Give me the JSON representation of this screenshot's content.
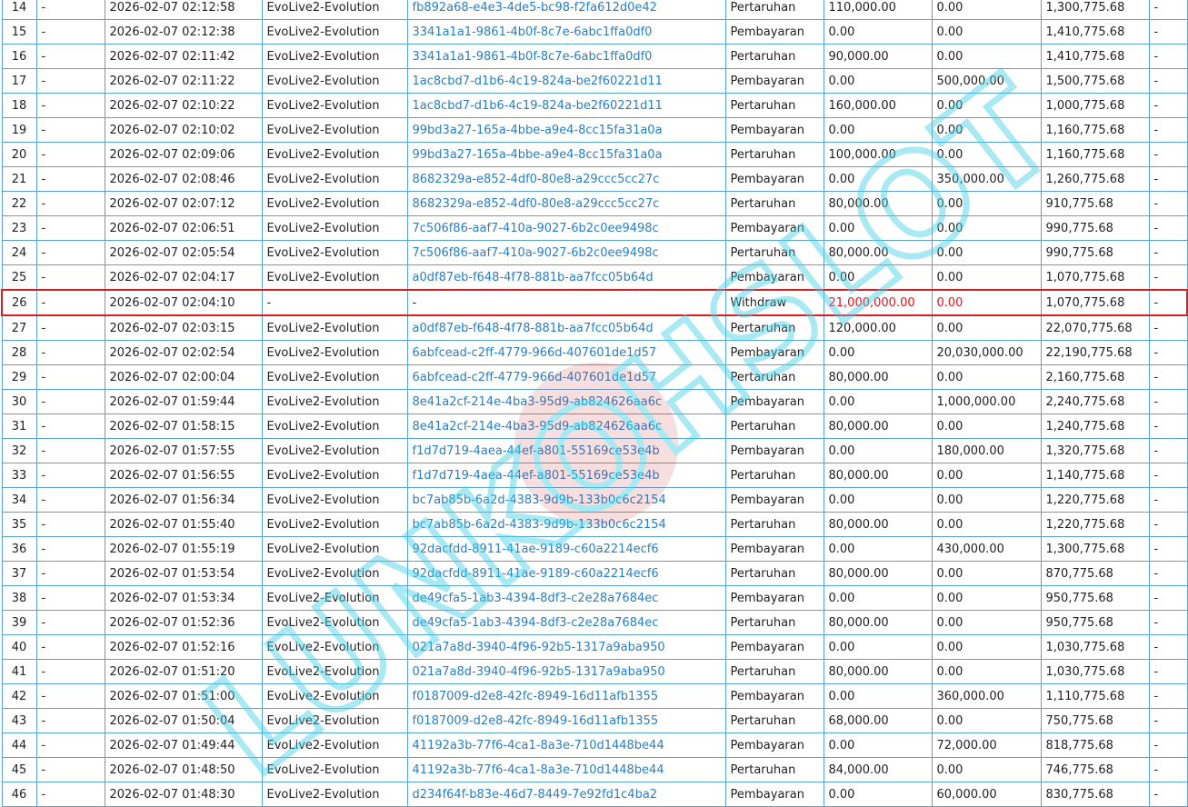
{
  "watermark": {
    "text": "LUNKOHSLOT",
    "color": "#3fd0e8"
  },
  "highlight_color": "#d91f26",
  "rows": [
    {
      "no": "14",
      "c2": "-",
      "date": "2026-02-07 02:12:58",
      "provider": "EvoLive2-Evolution",
      "id": "fb892a68-e4e3-4de5-bc98-f2fa612d0e42",
      "type": "Pertaruhan",
      "debit": "110,000.00",
      "credit": "0.00",
      "balance": "1,300,775.68",
      "c10": "-"
    },
    {
      "no": "15",
      "c2": "-",
      "date": "2026-02-07 02:12:38",
      "provider": "EvoLive2-Evolution",
      "id": "3341a1a1-9861-4b0f-8c7e-6abc1ffa0df0",
      "type": "Pembayaran",
      "debit": "0.00",
      "credit": "0.00",
      "balance": "1,410,775.68",
      "c10": "-"
    },
    {
      "no": "16",
      "c2": "-",
      "date": "2026-02-07 02:11:42",
      "provider": "EvoLive2-Evolution",
      "id": "3341a1a1-9861-4b0f-8c7e-6abc1ffa0df0",
      "type": "Pertaruhan",
      "debit": "90,000.00",
      "credit": "0.00",
      "balance": "1,410,775.68",
      "c10": "-"
    },
    {
      "no": "17",
      "c2": "-",
      "date": "2026-02-07 02:11:22",
      "provider": "EvoLive2-Evolution",
      "id": "1ac8cbd7-d1b6-4c19-824a-be2f60221d11",
      "type": "Pembayaran",
      "debit": "0.00",
      "credit": "500,000.00",
      "balance": "1,500,775.68",
      "c10": "-"
    },
    {
      "no": "18",
      "c2": "-",
      "date": "2026-02-07 02:10:22",
      "provider": "EvoLive2-Evolution",
      "id": "1ac8cbd7-d1b6-4c19-824a-be2f60221d11",
      "type": "Pertaruhan",
      "debit": "160,000.00",
      "credit": "0.00",
      "balance": "1,000,775.68",
      "c10": "-"
    },
    {
      "no": "19",
      "c2": "-",
      "date": "2026-02-07 02:10:02",
      "provider": "EvoLive2-Evolution",
      "id": "99bd3a27-165a-4bbe-a9e4-8cc15fa31a0a",
      "type": "Pembayaran",
      "debit": "0.00",
      "credit": "0.00",
      "balance": "1,160,775.68",
      "c10": "-"
    },
    {
      "no": "20",
      "c2": "-",
      "date": "2026-02-07 02:09:06",
      "provider": "EvoLive2-Evolution",
      "id": "99bd3a27-165a-4bbe-a9e4-8cc15fa31a0a",
      "type": "Pertaruhan",
      "debit": "100,000.00",
      "credit": "0.00",
      "balance": "1,160,775.68",
      "c10": "-"
    },
    {
      "no": "21",
      "c2": "-",
      "date": "2026-02-07 02:08:46",
      "provider": "EvoLive2-Evolution",
      "id": "8682329a-e852-4df0-80e8-a29ccc5cc27c",
      "type": "Pembayaran",
      "debit": "0.00",
      "credit": "350,000.00",
      "balance": "1,260,775.68",
      "c10": "-"
    },
    {
      "no": "22",
      "c2": "-",
      "date": "2026-02-07 02:07:12",
      "provider": "EvoLive2-Evolution",
      "id": "8682329a-e852-4df0-80e8-a29ccc5cc27c",
      "type": "Pertaruhan",
      "debit": "80,000.00",
      "credit": "0.00",
      "balance": "910,775.68",
      "c10": "-"
    },
    {
      "no": "23",
      "c2": "-",
      "date": "2026-02-07 02:06:51",
      "provider": "EvoLive2-Evolution",
      "id": "7c506f86-aaf7-410a-9027-6b2c0ee9498c",
      "type": "Pembayaran",
      "debit": "0.00",
      "credit": "0.00",
      "balance": "990,775.68",
      "c10": "-"
    },
    {
      "no": "24",
      "c2": "-",
      "date": "2026-02-07 02:05:54",
      "provider": "EvoLive2-Evolution",
      "id": "7c506f86-aaf7-410a-9027-6b2c0ee9498c",
      "type": "Pertaruhan",
      "debit": "80,000.00",
      "credit": "0.00",
      "balance": "990,775.68",
      "c10": "-"
    },
    {
      "no": "25",
      "c2": "-",
      "date": "2026-02-07 02:04:17",
      "provider": "EvoLive2-Evolution",
      "id": "a0df87eb-f648-4f78-881b-aa7fcc05b64d",
      "type": "Pembayaran",
      "debit": "0.00",
      "credit": "0.00",
      "balance": "1,070,775.68",
      "c10": "-"
    },
    {
      "no": "26",
      "c2": "-",
      "date": "2026-02-07 02:04:10",
      "provider": "-",
      "id": "-",
      "type": "Withdraw",
      "debit": "21,000,000.00",
      "credit": "0.00",
      "balance": "1,070,775.68",
      "c10": "-",
      "highlight": true
    },
    {
      "no": "27",
      "c2": "-",
      "date": "2026-02-07 02:03:15",
      "provider": "EvoLive2-Evolution",
      "id": "a0df87eb-f648-4f78-881b-aa7fcc05b64d",
      "type": "Pertaruhan",
      "debit": "120,000.00",
      "credit": "0.00",
      "balance": "22,070,775.68",
      "c10": "-"
    },
    {
      "no": "28",
      "c2": "-",
      "date": "2026-02-07 02:02:54",
      "provider": "EvoLive2-Evolution",
      "id": "6abfcead-c2ff-4779-966d-407601de1d57",
      "type": "Pembayaran",
      "debit": "0.00",
      "credit": "20,030,000.00",
      "balance": "22,190,775.68",
      "c10": "-"
    },
    {
      "no": "29",
      "c2": "-",
      "date": "2026-02-07 02:00:04",
      "provider": "EvoLive2-Evolution",
      "id": "6abfcead-c2ff-4779-966d-407601de1d57",
      "type": "Pertaruhan",
      "debit": "80,000.00",
      "credit": "0.00",
      "balance": "2,160,775.68",
      "c10": "-"
    },
    {
      "no": "30",
      "c2": "-",
      "date": "2026-02-07 01:59:44",
      "provider": "EvoLive2-Evolution",
      "id": "8e41a2cf-214e-4ba3-95d9-ab824626aa6c",
      "type": "Pembayaran",
      "debit": "0.00",
      "credit": "1,000,000.00",
      "balance": "2,240,775.68",
      "c10": "-"
    },
    {
      "no": "31",
      "c2": "-",
      "date": "2026-02-07 01:58:15",
      "provider": "EvoLive2-Evolution",
      "id": "8e41a2cf-214e-4ba3-95d9-ab824626aa6c",
      "type": "Pertaruhan",
      "debit": "80,000.00",
      "credit": "0.00",
      "balance": "1,240,775.68",
      "c10": "-"
    },
    {
      "no": "32",
      "c2": "-",
      "date": "2026-02-07 01:57:55",
      "provider": "EvoLive2-Evolution",
      "id": "f1d7d719-4aea-44ef-a801-55169ce53e4b",
      "type": "Pembayaran",
      "debit": "0.00",
      "credit": "180,000.00",
      "balance": "1,320,775.68",
      "c10": "-"
    },
    {
      "no": "33",
      "c2": "-",
      "date": "2026-02-07 01:56:55",
      "provider": "EvoLive2-Evolution",
      "id": "f1d7d719-4aea-44ef-a801-55169ce53e4b",
      "type": "Pertaruhan",
      "debit": "80,000.00",
      "credit": "0.00",
      "balance": "1,140,775.68",
      "c10": "-"
    },
    {
      "no": "34",
      "c2": "-",
      "date": "2026-02-07 01:56:34",
      "provider": "EvoLive2-Evolution",
      "id": "bc7ab85b-6a2d-4383-9d9b-133b0c6c2154",
      "type": "Pembayaran",
      "debit": "0.00",
      "credit": "0.00",
      "balance": "1,220,775.68",
      "c10": "-"
    },
    {
      "no": "35",
      "c2": "-",
      "date": "2026-02-07 01:55:40",
      "provider": "EvoLive2-Evolution",
      "id": "bc7ab85b-6a2d-4383-9d9b-133b0c6c2154",
      "type": "Pertaruhan",
      "debit": "80,000.00",
      "credit": "0.00",
      "balance": "1,220,775.68",
      "c10": "-"
    },
    {
      "no": "36",
      "c2": "-",
      "date": "2026-02-07 01:55:19",
      "provider": "EvoLive2-Evolution",
      "id": "92dacfdd-8911-41ae-9189-c60a2214ecf6",
      "type": "Pembayaran",
      "debit": "0.00",
      "credit": "430,000.00",
      "balance": "1,300,775.68",
      "c10": "-"
    },
    {
      "no": "37",
      "c2": "-",
      "date": "2026-02-07 01:53:54",
      "provider": "EvoLive2-Evolution",
      "id": "92dacfdd-8911-41ae-9189-c60a2214ecf6",
      "type": "Pertaruhan",
      "debit": "80,000.00",
      "credit": "0.00",
      "balance": "870,775.68",
      "c10": "-"
    },
    {
      "no": "38",
      "c2": "-",
      "date": "2026-02-07 01:53:34",
      "provider": "EvoLive2-Evolution",
      "id": "de49cfa5-1ab3-4394-8df3-c2e28a7684ec",
      "type": "Pembayaran",
      "debit": "0.00",
      "credit": "0.00",
      "balance": "950,775.68",
      "c10": "-"
    },
    {
      "no": "39",
      "c2": "-",
      "date": "2026-02-07 01:52:36",
      "provider": "EvoLive2-Evolution",
      "id": "de49cfa5-1ab3-4394-8df3-c2e28a7684ec",
      "type": "Pertaruhan",
      "debit": "80,000.00",
      "credit": "0.00",
      "balance": "950,775.68",
      "c10": "-"
    },
    {
      "no": "40",
      "c2": "-",
      "date": "2026-02-07 01:52:16",
      "provider": "EvoLive2-Evolution",
      "id": "021a7a8d-3940-4f96-92b5-1317a9aba950",
      "type": "Pembayaran",
      "debit": "0.00",
      "credit": "0.00",
      "balance": "1,030,775.68",
      "c10": "-"
    },
    {
      "no": "41",
      "c2": "-",
      "date": "2026-02-07 01:51:20",
      "provider": "EvoLive2-Evolution",
      "id": "021a7a8d-3940-4f96-92b5-1317a9aba950",
      "type": "Pertaruhan",
      "debit": "80,000.00",
      "credit": "0.00",
      "balance": "1,030,775.68",
      "c10": "-"
    },
    {
      "no": "42",
      "c2": "-",
      "date": "2026-02-07 01:51:00",
      "provider": "EvoLive2-Evolution",
      "id": "f0187009-d2e8-42fc-8949-16d11afb1355",
      "type": "Pembayaran",
      "debit": "0.00",
      "credit": "360,000.00",
      "balance": "1,110,775.68",
      "c10": "-"
    },
    {
      "no": "43",
      "c2": "-",
      "date": "2026-02-07 01:50:04",
      "provider": "EvoLive2-Evolution",
      "id": "f0187009-d2e8-42fc-8949-16d11afb1355",
      "type": "Pertaruhan",
      "debit": "68,000.00",
      "credit": "0.00",
      "balance": "750,775.68",
      "c10": "-"
    },
    {
      "no": "44",
      "c2": "-",
      "date": "2026-02-07 01:49:44",
      "provider": "EvoLive2-Evolution",
      "id": "41192a3b-77f6-4ca1-8a3e-710d1448be44",
      "type": "Pembayaran",
      "debit": "0.00",
      "credit": "72,000.00",
      "balance": "818,775.68",
      "c10": "-"
    },
    {
      "no": "45",
      "c2": "-",
      "date": "2026-02-07 01:48:50",
      "provider": "EvoLive2-Evolution",
      "id": "41192a3b-77f6-4ca1-8a3e-710d1448be44",
      "type": "Pertaruhan",
      "debit": "84,000.00",
      "credit": "0.00",
      "balance": "746,775.68",
      "c10": "-"
    },
    {
      "no": "46",
      "c2": "-",
      "date": "2026-02-07 01:48:30",
      "provider": "EvoLive2-Evolution",
      "id": "d234f64f-b83e-46d7-8449-7e92fd1c4ba2",
      "type": "Pembayaran",
      "debit": "0.00",
      "credit": "60,000.00",
      "balance": "830,775.68",
      "c10": "-"
    }
  ]
}
